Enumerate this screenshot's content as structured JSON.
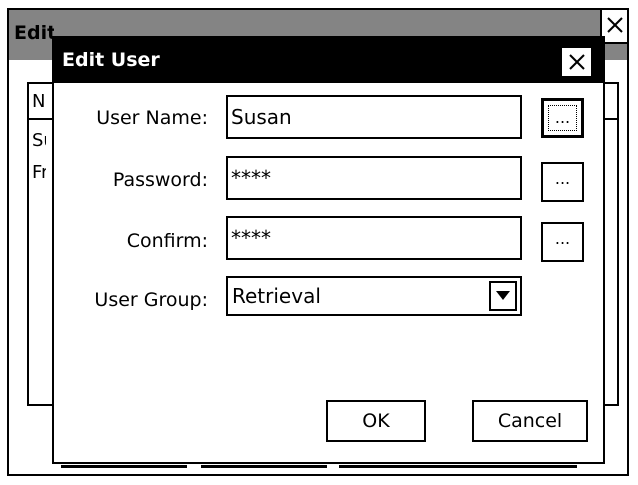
{
  "background_window": {
    "title": "Edit Users",
    "list_header": "Name",
    "rows": [
      "Susan",
      "Fred"
    ]
  },
  "dialog": {
    "title": "Edit User",
    "fields": {
      "user_name": {
        "label": "User Name:",
        "value": "Susan"
      },
      "password": {
        "label": "Password:",
        "value": "****"
      },
      "confirm": {
        "label": "Confirm:",
        "value": "****"
      },
      "user_group": {
        "label": "User Group:",
        "value": "Retrieval"
      }
    },
    "ellipsis_label": "...",
    "ok_label": "OK",
    "cancel_label": "Cancel"
  },
  "icons": {
    "close": "close-icon",
    "dropdown": "chevron-down-icon"
  }
}
